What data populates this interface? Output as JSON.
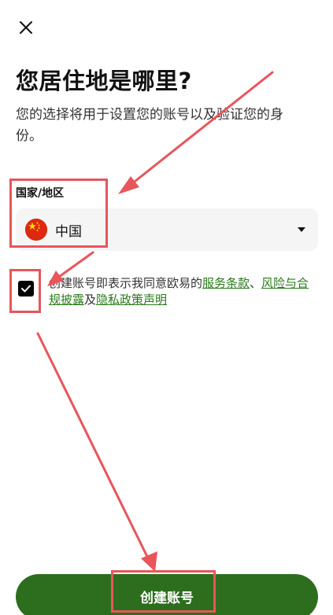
{
  "header": {
    "close_icon": "close-icon"
  },
  "page": {
    "title": "您居住地是哪里?",
    "subtitle": "您的选择将用于设置您的账号以及验证您的身份。"
  },
  "residence": {
    "label": "国家/地区",
    "selected_country": "中国",
    "flag_icon": "china-flag-icon",
    "caret_icon": "caret-down-icon"
  },
  "consent": {
    "checked": true,
    "text_prefix": "创建账号即表示我同意欧易的",
    "terms_link": "服务条款",
    "separator": "、",
    "risk_link": "风险与合规披露",
    "joiner": "及",
    "privacy_link": "隐私政策声明"
  },
  "actions": {
    "create_account_label": "创建账号"
  },
  "colors": {
    "primary_button": "#2c6e1e",
    "link": "#2a7a1a",
    "annotation": "#e8555b",
    "select_bg": "#f5f5f5"
  }
}
